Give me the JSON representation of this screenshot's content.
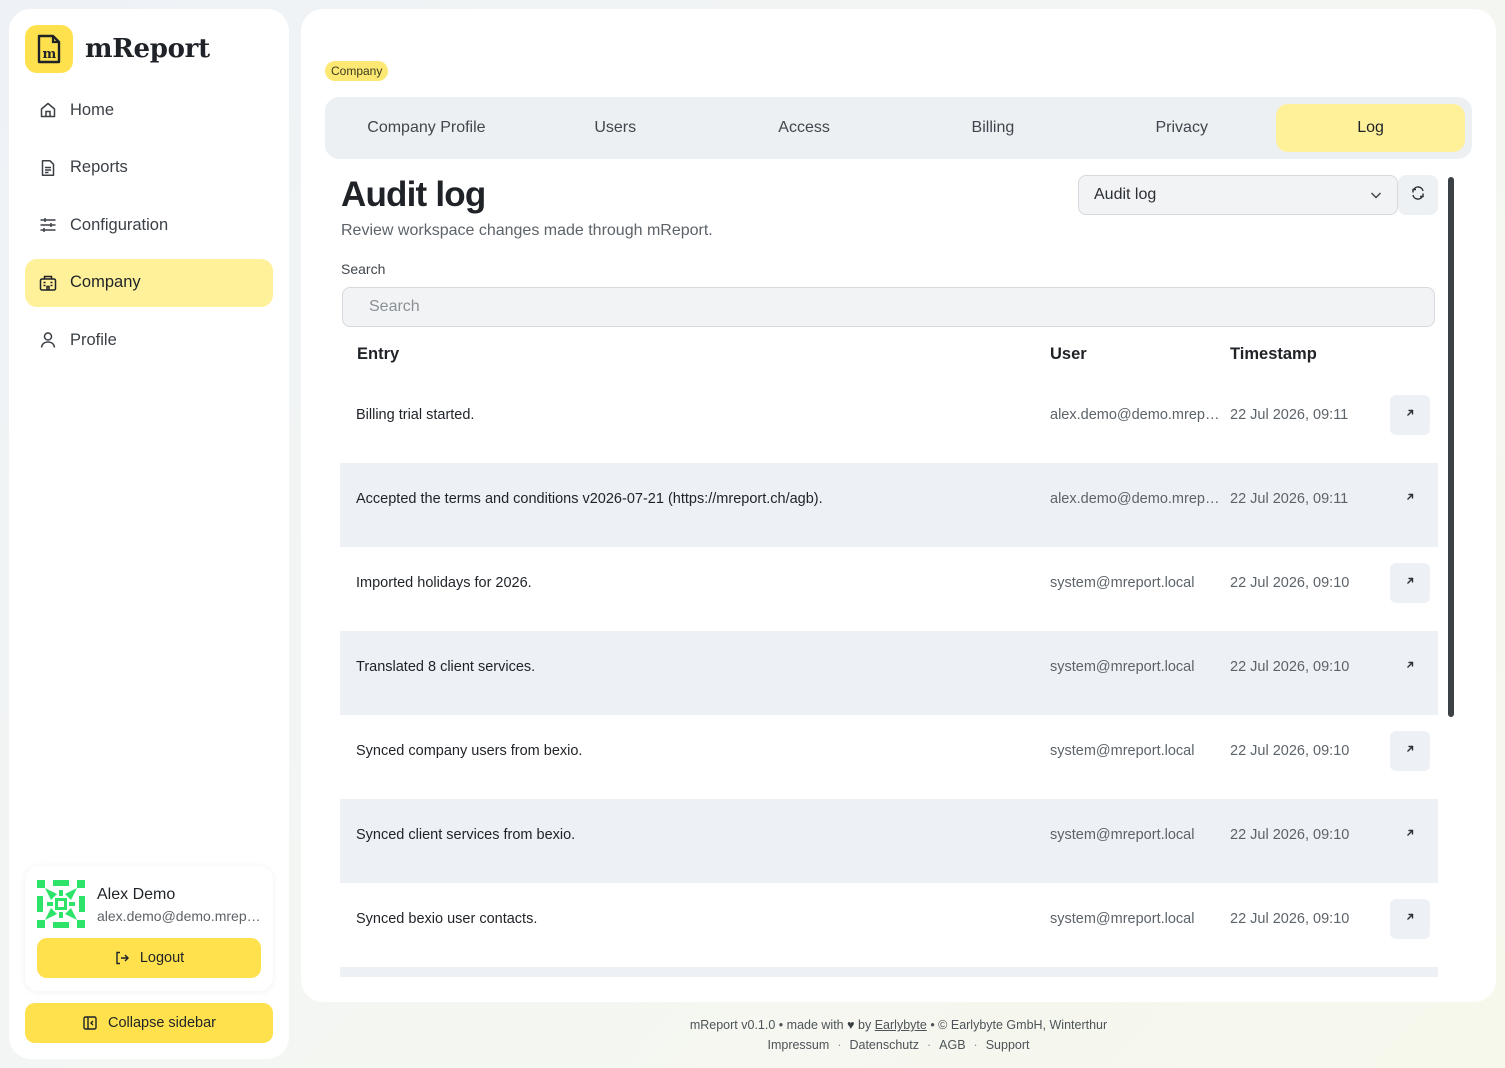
{
  "app": {
    "name": "mReport"
  },
  "sidebar": {
    "items": [
      {
        "label": "Home",
        "icon": "home-icon"
      },
      {
        "label": "Reports",
        "icon": "document-icon"
      },
      {
        "label": "Configuration",
        "icon": "sliders-icon"
      },
      {
        "label": "Company",
        "icon": "building-icon",
        "active": true
      },
      {
        "label": "Profile",
        "icon": "user-icon"
      }
    ],
    "user": {
      "name": "Alex Demo",
      "email": "alex.demo@demo.mreport.local"
    },
    "logout_label": "Logout",
    "collapse_label": "Collapse sidebar"
  },
  "breadcrumb": {
    "label": "Company"
  },
  "tabs": [
    {
      "label": "Company Profile"
    },
    {
      "label": "Users"
    },
    {
      "label": "Access"
    },
    {
      "label": "Billing"
    },
    {
      "label": "Privacy"
    },
    {
      "label": "Log",
      "active": true
    }
  ],
  "page": {
    "title": "Audit log",
    "subtitle": "Review workspace changes made through mReport.",
    "select_value": "Audit log"
  },
  "search": {
    "label": "Search",
    "placeholder": "Search"
  },
  "table": {
    "headers": {
      "entry": "Entry",
      "user": "User",
      "timestamp": "Timestamp"
    },
    "rows": [
      {
        "entry": "Billing trial started.",
        "user": "alex.demo@demo.mreport.local",
        "timestamp": "22 Jul 2026, 09:11"
      },
      {
        "entry": "Accepted the terms and conditions v2026-07-21 (https://mreport.ch/agb).",
        "user": "alex.demo@demo.mreport.local",
        "timestamp": "22 Jul 2026, 09:11"
      },
      {
        "entry": "Imported holidays for 2026.",
        "user": "system@mreport.local",
        "timestamp": "22 Jul 2026, 09:10"
      },
      {
        "entry": "Translated 8 client services.",
        "user": "system@mreport.local",
        "timestamp": "22 Jul 2026, 09:10"
      },
      {
        "entry": "Synced company users from bexio.",
        "user": "system@mreport.local",
        "timestamp": "22 Jul 2026, 09:10"
      },
      {
        "entry": "Synced client services from bexio.",
        "user": "system@mreport.local",
        "timestamp": "22 Jul 2026, 09:10"
      },
      {
        "entry": "Synced bexio user contacts.",
        "user": "system@mreport.local",
        "timestamp": "22 Jul 2026, 09:10"
      }
    ]
  },
  "footer": {
    "version": "mReport v0.1.0",
    "made_with": "made with",
    "by": "by",
    "author_link": "Earlybyte",
    "copyright": "© Earlybyte GmbH, Winterthur",
    "links": [
      "Impressum",
      "Datenschutz",
      "AGB",
      "Support"
    ]
  },
  "colors": {
    "accent": "#ffe14d",
    "active_bg": "#fff09a",
    "row_alt": "#edf0f4"
  }
}
